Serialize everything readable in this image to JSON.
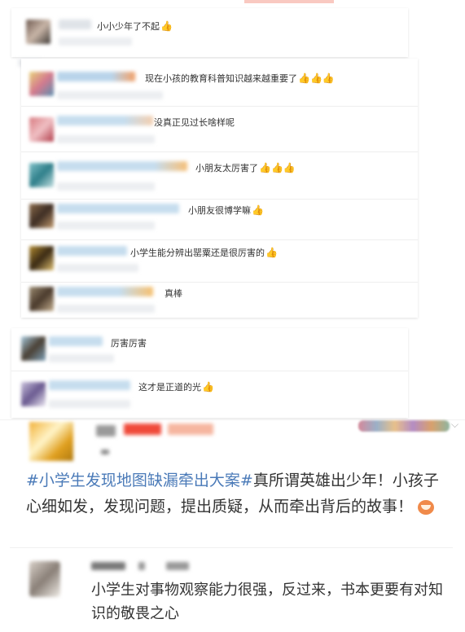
{
  "comments": [
    {
      "text": "小小少年了不起",
      "thumbs": "👍"
    },
    {
      "text": "现在小孩的教育科普知识越来越重要了",
      "thumbs": "👍👍👍"
    },
    {
      "text": "没真正见过长啥样呢",
      "thumbs": ""
    },
    {
      "text": "小朋友太厉害了",
      "thumbs": "👍👍👍"
    },
    {
      "text": "小朋友很博学嘛",
      "thumbs": "👍"
    },
    {
      "text": "小学生能分辨出罂粟还是很厉害的",
      "thumbs": "👍"
    },
    {
      "text": "真棒",
      "thumbs": ""
    },
    {
      "text": "厉害厉害",
      "thumbs": ""
    },
    {
      "text": "这才是正道的光",
      "thumbs": "👍"
    }
  ],
  "post": {
    "hashtag": "#小学生发现地图缺漏牵出大案#",
    "body": "真所谓英雄出少年！小孩子心细如发，发现问题，提出质疑，从而牵出背后的故事！"
  },
  "reply": {
    "text": "小学生对事物观察能力很强，反过来，书本更要有对知识的敬畏之心"
  },
  "icons": {
    "thumb": "thumbs-up-icon",
    "face": "grinning-face-icon",
    "expand": "chevron-down-icon"
  }
}
